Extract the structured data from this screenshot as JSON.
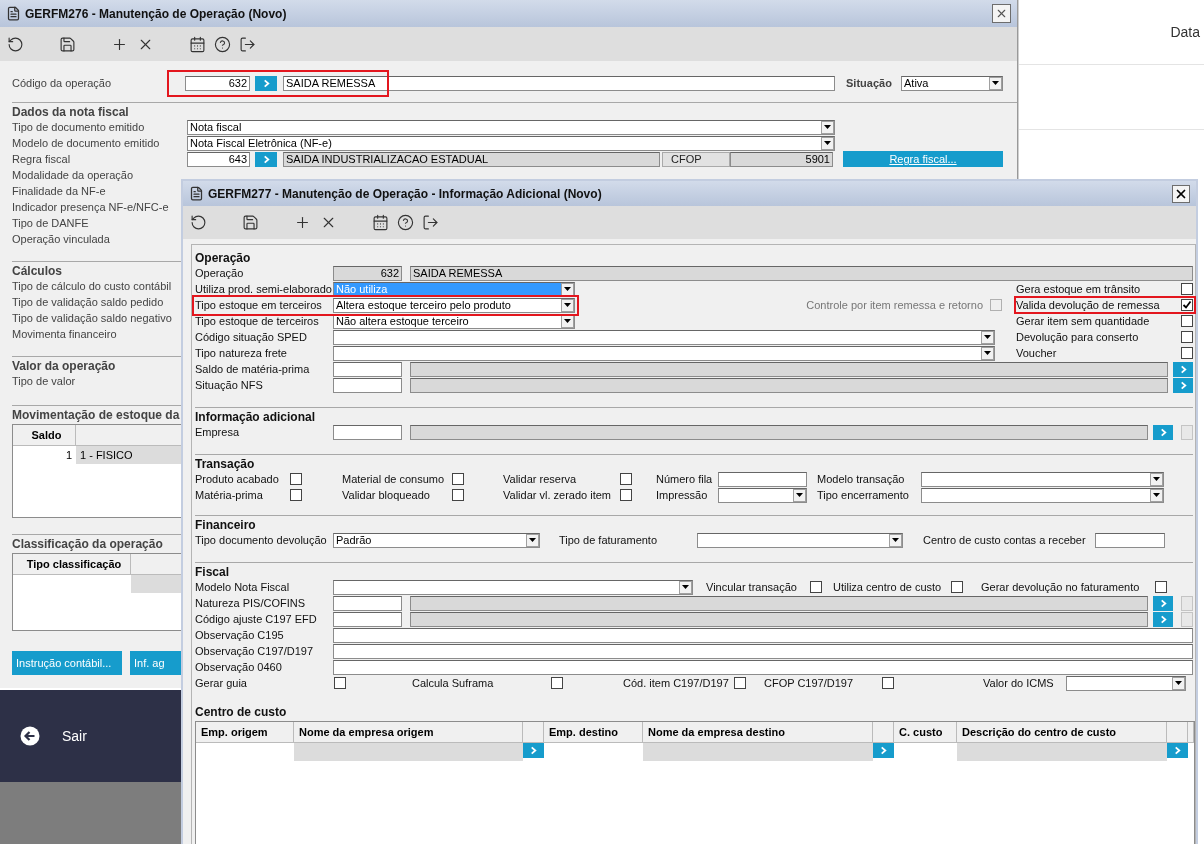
{
  "desktop": {
    "header_label": "Data",
    "exit_label": "Sair"
  },
  "main_window": {
    "title": "GERFM276 - Manutenção de Operação (Novo)",
    "operation": {
      "label": "Código da operação",
      "code": "632",
      "name": "SAIDA REMESSA",
      "highlighted": true
    },
    "situation": {
      "label": "Situação",
      "value": "Ativa"
    },
    "invoice": {
      "title": "Dados da nota fiscal",
      "rows": [
        {
          "kind": "select",
          "label": "Tipo de documento emitido",
          "value": "Nota fiscal"
        },
        {
          "kind": "select",
          "label": "Modelo de documento emitido",
          "value": "Nota Fiscal Eletrônica (NF-e)"
        },
        {
          "kind": "rule",
          "label": "Regra fiscal",
          "code": "643",
          "name": "SAIDA INDUSTRIALIZACAO ESTADUAL",
          "cfop_label": "CFOP",
          "cfop": "5901",
          "button": "Regra fiscal..."
        },
        {
          "kind": "label",
          "label": "Modalidade da operação"
        },
        {
          "kind": "label",
          "label": "Finalidade da NF-e"
        },
        {
          "kind": "label",
          "label": "Indicador presença NF-e/NFC-e"
        },
        {
          "kind": "label",
          "label": "Tipo de DANFE"
        },
        {
          "kind": "label",
          "label": "Operação vinculada"
        }
      ]
    },
    "sections": [
      {
        "title": "Cálculos",
        "labels": [
          "Tipo de cálculo do custo contábil",
          "Tipo de validação saldo pedido",
          "Tipo de validação saldo negativo",
          "Movimenta financeiro"
        ]
      },
      {
        "title": "Valor da operação",
        "labels": [
          "Tipo de valor"
        ]
      }
    ],
    "stock": {
      "title": "Movimentação de estoque da",
      "columns": [
        "Saldo"
      ],
      "rows": [
        [
          "1",
          "1 - FISICO"
        ]
      ]
    },
    "classification": {
      "title": "Classificação da operação",
      "columns": [
        "Tipo classificação"
      ]
    },
    "buttons": [
      "Instrução contábil...",
      "Inf. ag"
    ]
  },
  "dialog": {
    "title": "GERFM277 - Manutenção de Operação - Informação Adicional (Novo)",
    "operation": {
      "title": "Operação",
      "rows": [
        {
          "kind": "readonly",
          "label": "Operação",
          "code": "632",
          "name": "SAIDA REMESSA"
        },
        {
          "kind": "select",
          "label": "Utiliza prod. semi-elaborado",
          "value": "Não utiliza",
          "focused": true,
          "flags": [
            {
              "label": "Gera estoque em trânsito",
              "checked": false,
              "disabled": false
            }
          ]
        },
        {
          "kind": "select",
          "label": "Tipo estoque em terceiros",
          "value": "Altera estoque terceiro pelo produto",
          "focused": false,
          "highlighted": true,
          "flags": [
            {
              "label": "Controle por item remessa e retorno",
              "checked": false,
              "disabled": true
            },
            {
              "label": "Valida devolução de remessa",
              "checked": true,
              "disabled": false,
              "highlighted": true
            }
          ]
        },
        {
          "kind": "select",
          "label": "Tipo estoque de terceiros",
          "value": "Não altera estoque terceiro",
          "focused": false,
          "flags": [
            {
              "label": "Gerar item sem quantidade",
              "checked": false,
              "disabled": false
            }
          ]
        },
        {
          "kind": "wide_select",
          "label": "Código situação SPED",
          "flags": [
            {
              "label": "Devolução para conserto",
              "checked": false,
              "disabled": false
            }
          ]
        },
        {
          "kind": "wide_select",
          "label": "Tipo natureza frete",
          "flags": [
            {
              "label": "Voucher",
              "checked": false,
              "disabled": false
            }
          ]
        },
        {
          "kind": "lookup",
          "label": "Saldo de matéria-prima"
        },
        {
          "kind": "lookup",
          "label": "Situação NFS"
        }
      ]
    },
    "additional": {
      "title": "Informação adicional",
      "rows": [
        {
          "kind": "lookup",
          "label": "Empresa"
        }
      ]
    },
    "transaction": {
      "title": "Transação",
      "rows": [
        [
          {
            "kind": "check",
            "label": "Produto acabado",
            "checked": false
          },
          {
            "kind": "check",
            "label": "Material de consumo",
            "checked": false
          },
          {
            "kind": "check",
            "label": "Validar reserva",
            "checked": false
          },
          {
            "kind": "text",
            "label": "Número fila"
          },
          {
            "kind": "select",
            "label": "Modelo transação"
          }
        ],
        [
          {
            "kind": "check",
            "label": "Matéria-prima",
            "checked": false
          },
          {
            "kind": "check",
            "label": "Validar bloqueado",
            "checked": false
          },
          {
            "kind": "check",
            "label": "Validar vl. zerado item",
            "checked": false
          },
          {
            "kind": "select",
            "label": "Impressão"
          },
          {
            "kind": "select",
            "label": "Tipo encerramento"
          }
        ]
      ]
    },
    "financial": {
      "title": "Financeiro",
      "items": [
        {
          "kind": "select",
          "label": "Tipo documento devolução",
          "value": "Padrão"
        },
        {
          "kind": "select",
          "label": "Tipo de faturamento"
        },
        {
          "kind": "text",
          "label": "Centro de custo contas a receber"
        }
      ]
    },
    "fiscal": {
      "title": "Fiscal",
      "rows": [
        {
          "kind": "items",
          "items": [
            {
              "kind": "select",
              "label": "Modelo Nota Fiscal"
            },
            {
              "kind": "check",
              "label": "Vincular transação",
              "checked": false
            },
            {
              "kind": "check",
              "label": "Utiliza centro de custo",
              "checked": false
            },
            {
              "kind": "check",
              "label": "Gerar devolução no faturamento",
              "checked": false
            }
          ]
        },
        {
          "kind": "lookup",
          "label": "Natureza PIS/COFINS"
        },
        {
          "kind": "lookup",
          "label": "Código ajuste C197 EFD"
        },
        {
          "kind": "text",
          "label": "Observação C195"
        },
        {
          "kind": "text",
          "label": "Observação C197/D197"
        },
        {
          "kind": "text",
          "label": "Observação 0460"
        },
        {
          "kind": "items",
          "items": [
            {
              "kind": "check",
              "label": "Gerar guia",
              "checked": false
            },
            {
              "kind": "check",
              "label": "Calcula Suframa",
              "checked": false
            },
            {
              "kind": "check",
              "label": "Cód. item C197/D197",
              "checked": false
            },
            {
              "kind": "check",
              "label": "CFOP C197/D197",
              "checked": false
            },
            {
              "kind": "select",
              "label": "Valor do ICMS"
            }
          ]
        }
      ]
    },
    "cost_centers": {
      "title": "Centro de custo",
      "columns": [
        {
          "label": "Emp. origem",
          "lookup": false
        },
        {
          "label": "Nome da empresa origem",
          "lookup": true
        },
        {
          "label": "Emp. destino",
          "lookup": false
        },
        {
          "label": "Nome da empresa destino",
          "lookup": true
        },
        {
          "label": "C. custo",
          "lookup": false
        },
        {
          "label": "Descrição do centro de custo",
          "lookup": true
        }
      ]
    }
  }
}
